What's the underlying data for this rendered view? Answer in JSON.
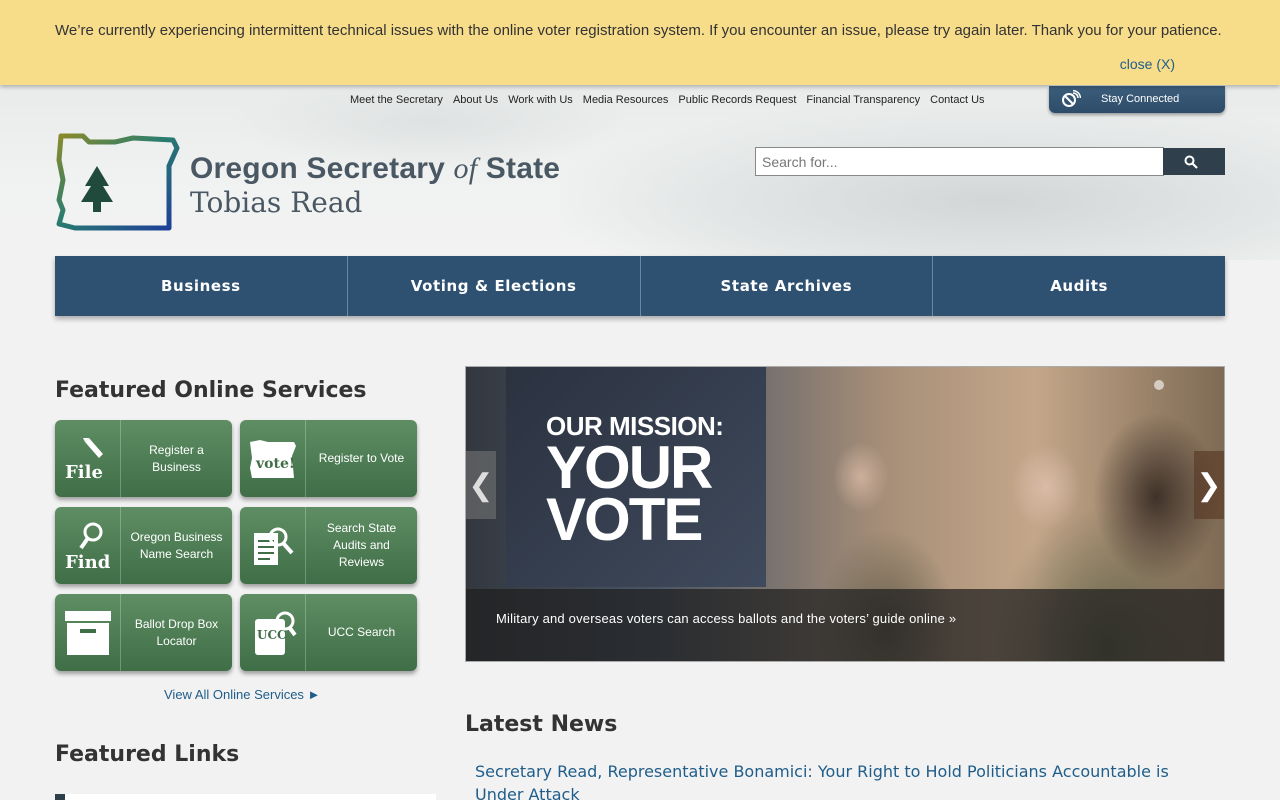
{
  "alert": {
    "message": "We’re currently experiencing intermittent technical issues with the online voter registration system. If you encounter an issue, please try again later. Thank you for your patience.",
    "close_label": "close (X)"
  },
  "utility_nav": {
    "items": [
      "Meet the Secretary",
      "About Us",
      "Work with Us",
      "Media Resources",
      "Public Records Request",
      "Financial Transparency",
      "Contact Us"
    ],
    "stay_connected": "Stay Connected"
  },
  "logo": {
    "title_part1": "Oregon Secretary ",
    "title_of": "of",
    "title_part2": " State",
    "subtitle": "Tobias Read"
  },
  "search": {
    "placeholder": "Search for..."
  },
  "main_nav": {
    "items": [
      "Business",
      "Voting & Elections",
      "State Archives",
      "Audits"
    ]
  },
  "featured_services": {
    "heading": "Featured Online Services",
    "items": [
      {
        "label": "Register a Business",
        "icon": "file-pen-icon",
        "icon_text": "File"
      },
      {
        "label": "Register to Vote",
        "icon": "oregon-vote-icon",
        "icon_text": "vote!"
      },
      {
        "label": "Oregon Business Name Search",
        "icon": "find-magnifier-icon",
        "icon_text": "Find"
      },
      {
        "label": "Search State Audits and Reviews",
        "icon": "document-search-icon"
      },
      {
        "label": "Ballot Drop Box Locator",
        "icon": "drop-box-icon"
      },
      {
        "label": "UCC Search",
        "icon": "ucc-search-icon",
        "icon_text": "UCC"
      }
    ],
    "view_all": "View All Online Services ►"
  },
  "carousel": {
    "mission_line1": "OUR MISSION:",
    "mission_line2": "YOUR",
    "mission_line3": "VOTE",
    "caption": "Military and overseas voters can access ballots and the voters’ guide online »",
    "prev_label": "❮",
    "next_label": "❯"
  },
  "featured_links": {
    "heading": "Featured Links"
  },
  "latest_news": {
    "heading": "Latest News",
    "items": [
      "Secretary Read, Representative Bonamici: Your Right to Hold Politicians Accountable is Under Attack"
    ]
  }
}
